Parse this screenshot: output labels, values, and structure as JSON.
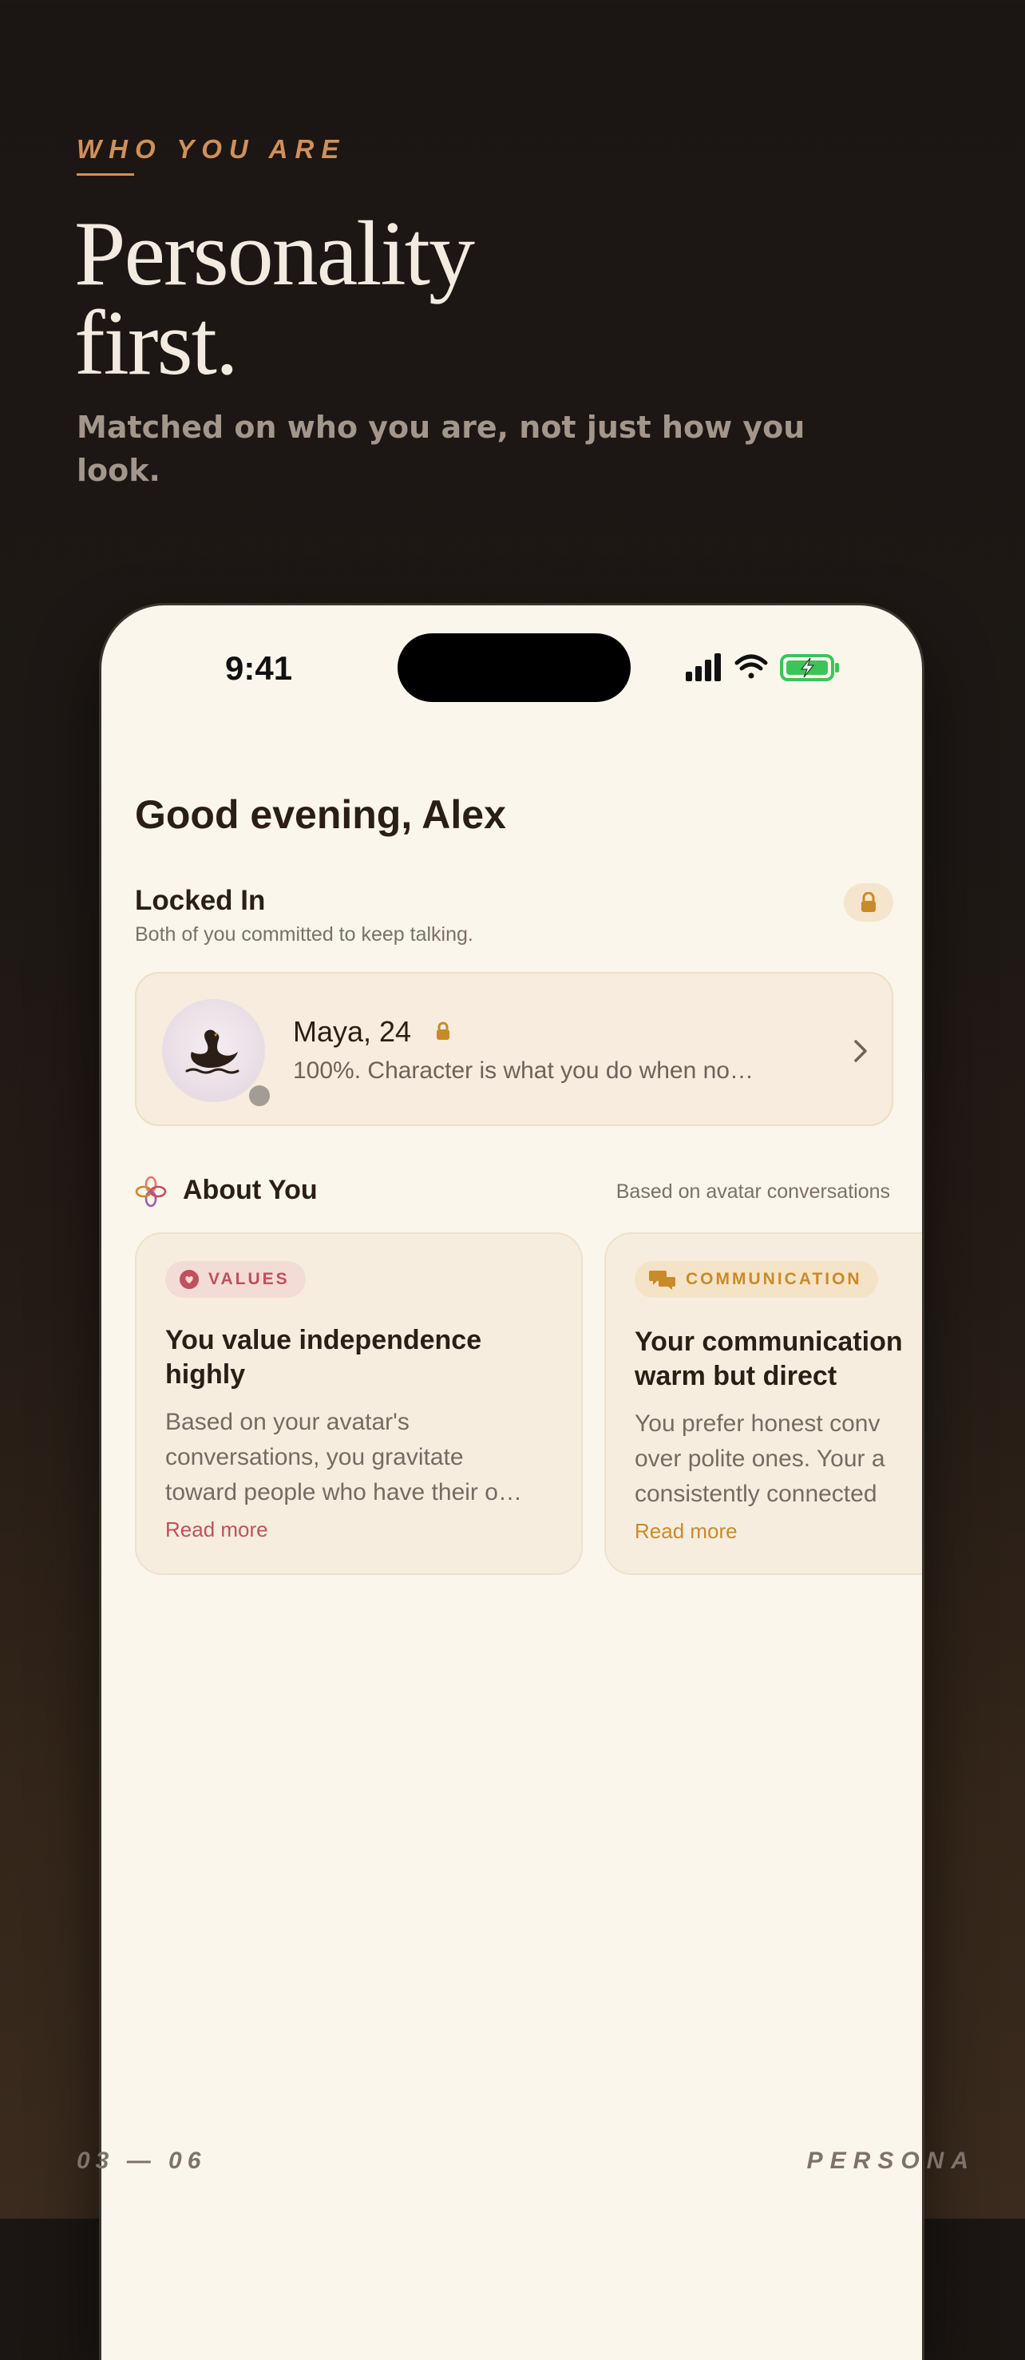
{
  "promo": {
    "eyebrow": "WHO YOU ARE",
    "headline": "Personality\nfirst.",
    "subhead": "Matched on who you are, not just how you look.",
    "page_indicator": "03 — 06",
    "brand": "PERSONA"
  },
  "status_bar": {
    "time": "9:41",
    "icons": [
      "cellular-signal-icon",
      "wifi-icon",
      "battery-charging-icon"
    ],
    "battery_color": "#3cc45a"
  },
  "home": {
    "greeting": "Good evening, Alex",
    "locked_in": {
      "title": "Locked In",
      "subtitle": "Both of you committed to keep talking.",
      "badge_icon": "lock-icon"
    },
    "match": {
      "name": "Maya, 24",
      "avatar_icon": "swan-icon",
      "status_icon": "lock-icon",
      "message": "100%. Character is what you do when no…"
    },
    "about": {
      "title": "About You",
      "note": "Based on avatar conversations",
      "cards": [
        {
          "chip": "VALUES",
          "chip_icon": "heart-icon",
          "title": "You value independence\nhighly",
          "body": "Based on your avatar's\nconversations, you gravitate\ntoward people who have their o…",
          "more": "Read more",
          "accent": "#c0505e"
        },
        {
          "chip": "COMMUNICATION",
          "chip_icon": "chat-bubbles-icon",
          "title": "Your communication\nwarm but direct",
          "body": "You prefer honest conv\nover polite ones. Your a\nconsistently connected",
          "more": "Read more",
          "accent": "#c98a2a"
        }
      ]
    }
  }
}
